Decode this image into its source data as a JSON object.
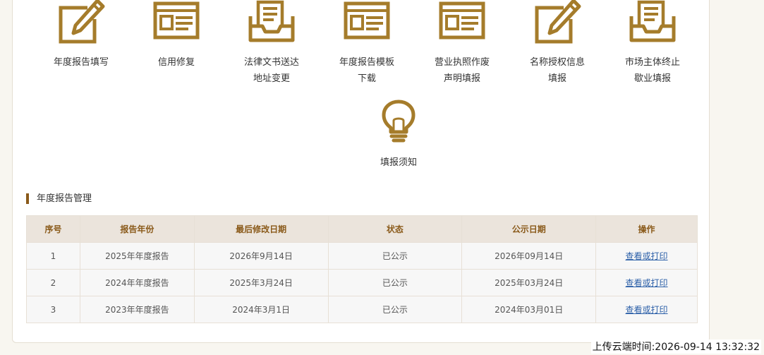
{
  "colors": {
    "icon": "#a57c2b",
    "section_bar": "#8a5a1a",
    "header_bg": "#ebe4dc",
    "link": "#2b5fa8"
  },
  "icons": [
    {
      "icon": "edit-icon",
      "label": "年度报告填写"
    },
    {
      "icon": "form-icon",
      "label": "信用修复"
    },
    {
      "icon": "tray-icon",
      "label": "法律文书送达\n地址变更"
    },
    {
      "icon": "form-icon",
      "label": "年度报告模板\n下载"
    },
    {
      "icon": "form-icon",
      "label": "营业执照作废\n声明填报"
    },
    {
      "icon": "edit-icon",
      "label": "名称授权信息\n填报"
    },
    {
      "icon": "tray-icon",
      "label": "市场主体终止\n歇业填报"
    }
  ],
  "notice": {
    "icon": "lightbulb-icon",
    "label": "填报须知"
  },
  "section": {
    "title": "年度报告管理"
  },
  "table": {
    "headers": [
      "序号",
      "报告年份",
      "最后修改日期",
      "状态",
      "公示日期",
      "操作"
    ],
    "rows": [
      [
        "1",
        "2025年年度报告",
        "2026年9月14日",
        "已公示",
        "2026年09月14日",
        "查看或打印"
      ],
      [
        "2",
        "2024年年度报告",
        "2025年3月24日",
        "已公示",
        "2025年03月24日",
        "查看或打印"
      ],
      [
        "3",
        "2023年年度报告",
        "2024年3月1日",
        "已公示",
        "2024年03月01日",
        "查看或打印"
      ]
    ]
  },
  "footer": {
    "upload_time": "上传云端时间:2026-09-14 13:32:32"
  }
}
